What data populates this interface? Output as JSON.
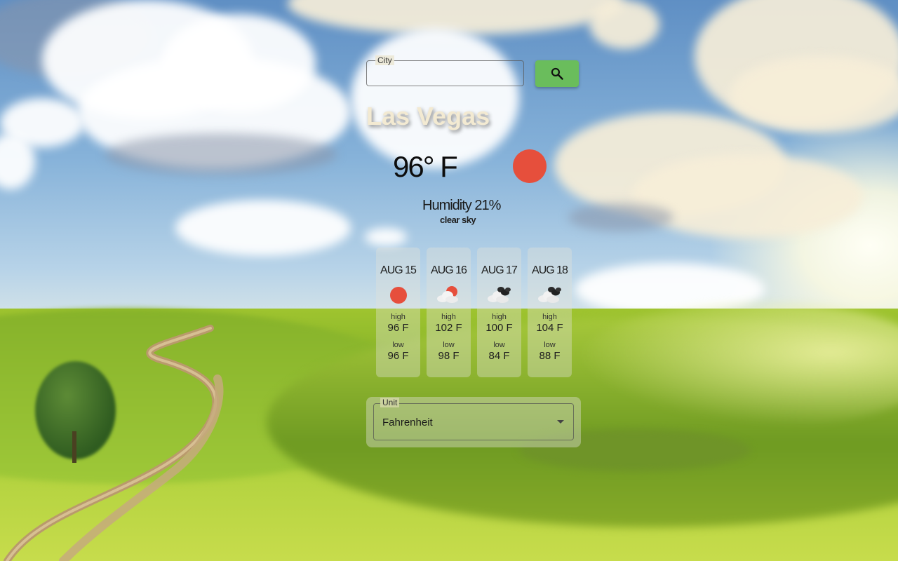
{
  "search": {
    "label": "City",
    "value": "",
    "placeholder": "",
    "button_icon": "search-icon",
    "button_color": "#6abd5c"
  },
  "current": {
    "city": "Las Vegas",
    "temperature": "96° F",
    "humidity": "Humidity 21%",
    "description": "clear sky",
    "icon": "sun-icon",
    "icon_color": "#e64f3c"
  },
  "forecast": [
    {
      "date": "AUG 15",
      "icon": "sun-icon",
      "high_label": "high",
      "high": "96 F",
      "low_label": "low",
      "low": "96 F"
    },
    {
      "date": "AUG 16",
      "icon": "sun-behind-cloud-icon",
      "high_label": "high",
      "high": "102 F",
      "low_label": "low",
      "low": "98 F"
    },
    {
      "date": "AUG 17",
      "icon": "broken-clouds-icon",
      "high_label": "high",
      "high": "100 F",
      "low_label": "low",
      "low": "84 F"
    },
    {
      "date": "AUG 18",
      "icon": "broken-clouds-icon",
      "high_label": "high",
      "high": "104 F",
      "low_label": "low",
      "low": "88 F"
    }
  ],
  "unit": {
    "label": "Unit",
    "value": "Fahrenheit"
  }
}
